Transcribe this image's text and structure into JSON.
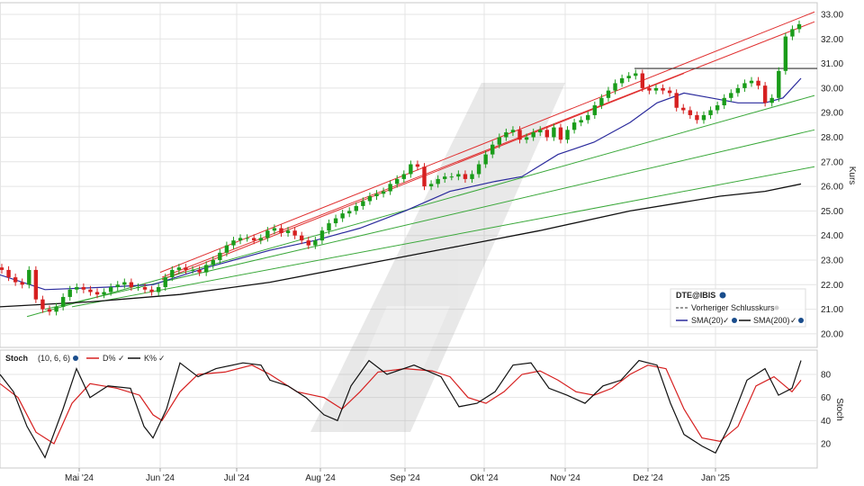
{
  "chart_data": {
    "type": "candlestick",
    "symbol": "DTE@IBIS",
    "x_labels": [
      "Mai '24",
      "Jun '24",
      "Jul '24",
      "Aug '24",
      "Sep '24",
      "Okt '24",
      "Nov '24",
      "Dez '24",
      "Jan '25"
    ],
    "price_panel": {
      "ylabel": "Kurs",
      "ylim": [
        19.6,
        33.3
      ],
      "yticks": [
        "33.00",
        "32.00",
        "31.00",
        "30.00",
        "29.00",
        "28.00",
        "27.00",
        "26.00",
        "25.00",
        "24.00",
        "23.00",
        "22.00",
        "21.00",
        "20.00"
      ],
      "close_series": [
        22.6,
        22.3,
        22.1,
        22.0,
        22.6,
        21.4,
        21.0,
        20.9,
        21.1,
        21.5,
        21.8,
        21.9,
        21.8,
        21.7,
        21.6,
        21.7,
        21.9,
        22.0,
        22.1,
        21.9,
        21.9,
        21.8,
        21.7,
        21.9,
        22.3,
        22.6,
        22.7,
        22.6,
        22.6,
        22.5,
        22.8,
        23.0,
        23.3,
        23.6,
        23.8,
        23.9,
        23.9,
        23.8,
        23.9,
        24.2,
        24.3,
        24.1,
        24.2,
        24.0,
        23.8,
        23.6,
        23.8,
        24.2,
        24.5,
        24.7,
        24.9,
        25.0,
        25.2,
        25.4,
        25.6,
        25.7,
        25.8,
        26.1,
        26.3,
        26.5,
        26.9,
        26.8,
        26.0,
        26.1,
        26.3,
        26.4,
        26.4,
        26.5,
        26.3,
        26.5,
        26.9,
        27.3,
        27.7,
        28.0,
        28.2,
        28.3,
        27.9,
        28.0,
        28.2,
        28.3,
        28.0,
        28.4,
        27.9,
        28.3,
        28.6,
        28.7,
        28.9,
        29.3,
        29.6,
        29.9,
        30.2,
        30.4,
        30.5,
        30.6,
        30.0,
        29.9,
        30.0,
        29.9,
        29.8,
        29.2,
        29.1,
        28.9,
        28.7,
        28.9,
        29.1,
        29.3,
        29.6,
        29.8,
        30.0,
        30.2,
        30.3,
        30.1,
        29.4,
        29.6,
        30.7,
        32.1,
        32.4,
        32.6
      ],
      "close_x_start": 2,
      "close_x_end": 888,
      "sma20": [
        [
          0,
          22.4
        ],
        [
          50,
          21.8
        ],
        [
          120,
          21.9
        ],
        [
          170,
          22.0
        ],
        [
          230,
          22.7
        ],
        [
          300,
          23.4
        ],
        [
          350,
          23.8
        ],
        [
          400,
          24.3
        ],
        [
          450,
          25.0
        ],
        [
          500,
          25.8
        ],
        [
          550,
          26.2
        ],
        [
          580,
          26.4
        ],
        [
          620,
          27.3
        ],
        [
          660,
          27.8
        ],
        [
          700,
          28.6
        ],
        [
          730,
          29.4
        ],
        [
          760,
          29.8
        ],
        [
          790,
          29.6
        ],
        [
          820,
          29.4
        ],
        [
          850,
          29.4
        ],
        [
          870,
          29.6
        ],
        [
          890,
          30.4
        ]
      ],
      "sma200": [
        [
          0,
          21.1
        ],
        [
          100,
          21.3
        ],
        [
          200,
          21.6
        ],
        [
          300,
          22.1
        ],
        [
          400,
          22.8
        ],
        [
          500,
          23.5
        ],
        [
          600,
          24.2
        ],
        [
          700,
          25.0
        ],
        [
          800,
          25.6
        ],
        [
          850,
          25.8
        ],
        [
          890,
          26.1
        ]
      ],
      "red_channel": [
        {
          "from": [
            178,
            22.5
          ],
          "to": [
            905,
            33.1
          ]
        },
        {
          "from": [
            180,
            22.3
          ],
          "to": [
            905,
            32.7
          ]
        },
        {
          "from": [
            180,
            22.2
          ],
          "to": [
            760,
            30.6
          ]
        }
      ],
      "green_lines": [
        {
          "from": [
            30,
            20.7
          ],
          "to": [
            905,
            29.7
          ]
        },
        {
          "from": [
            50,
            21.0
          ],
          "to": [
            905,
            28.3
          ]
        },
        {
          "from": [
            80,
            21.1
          ],
          "to": [
            905,
            26.8
          ]
        }
      ],
      "resistance": {
        "from": [
          705,
          30.8
        ],
        "to": [
          908,
          30.8
        ]
      },
      "legend": {
        "title": "DTE@IBIS",
        "entries": [
          "Vorheriger Schlusskurs",
          "SMA(20)",
          "SMA(200)"
        ]
      }
    },
    "stoch_panel": {
      "label": "Stoch",
      "params": "(10, 6, 6)",
      "ylabel": "Stoch",
      "ylim": [
        5,
        100
      ],
      "yticks": [
        "80",
        "60",
        "40",
        "20"
      ],
      "series": [
        {
          "name": "D%",
          "color": "#d62020",
          "values": [
            [
              0,
              72
            ],
            [
              20,
              60
            ],
            [
              40,
              30
            ],
            [
              60,
              20
            ],
            [
              80,
              55
            ],
            [
              100,
              72
            ],
            [
              130,
              68
            ],
            [
              155,
              62
            ],
            [
              170,
              45
            ],
            [
              180,
              40
            ],
            [
              200,
              65
            ],
            [
              220,
              80
            ],
            [
              250,
              82
            ],
            [
              280,
              88
            ],
            [
              300,
              80
            ],
            [
              330,
              65
            ],
            [
              360,
              60
            ],
            [
              380,
              50
            ],
            [
              400,
              65
            ],
            [
              420,
              82
            ],
            [
              450,
              85
            ],
            [
              480,
              83
            ],
            [
              500,
              78
            ],
            [
              520,
              60
            ],
            [
              540,
              55
            ],
            [
              560,
              65
            ],
            [
              580,
              80
            ],
            [
              600,
              83
            ],
            [
              620,
              75
            ],
            [
              640,
              65
            ],
            [
              660,
              62
            ],
            [
              680,
              68
            ],
            [
              700,
              80
            ],
            [
              720,
              88
            ],
            [
              740,
              85
            ],
            [
              760,
              50
            ],
            [
              780,
              25
            ],
            [
              800,
              22
            ],
            [
              820,
              35
            ],
            [
              840,
              70
            ],
            [
              860,
              78
            ],
            [
              880,
              65
            ],
            [
              890,
              75
            ]
          ]
        },
        {
          "name": "K%",
          "color": "#111111",
          "values": [
            [
              0,
              80
            ],
            [
              15,
              65
            ],
            [
              30,
              35
            ],
            [
              50,
              8
            ],
            [
              70,
              50
            ],
            [
              85,
              85
            ],
            [
              100,
              60
            ],
            [
              120,
              70
            ],
            [
              145,
              68
            ],
            [
              160,
              35
            ],
            [
              170,
              25
            ],
            [
              185,
              50
            ],
            [
              200,
              90
            ],
            [
              220,
              78
            ],
            [
              240,
              85
            ],
            [
              270,
              90
            ],
            [
              290,
              88
            ],
            [
              300,
              75
            ],
            [
              320,
              70
            ],
            [
              340,
              60
            ],
            [
              360,
              45
            ],
            [
              375,
              40
            ],
            [
              390,
              70
            ],
            [
              410,
              92
            ],
            [
              430,
              80
            ],
            [
              460,
              88
            ],
            [
              490,
              78
            ],
            [
              510,
              52
            ],
            [
              530,
              55
            ],
            [
              550,
              65
            ],
            [
              570,
              88
            ],
            [
              590,
              90
            ],
            [
              610,
              68
            ],
            [
              630,
              62
            ],
            [
              650,
              55
            ],
            [
              670,
              70
            ],
            [
              690,
              75
            ],
            [
              710,
              92
            ],
            [
              730,
              88
            ],
            [
              745,
              55
            ],
            [
              760,
              28
            ],
            [
              780,
              18
            ],
            [
              795,
              12
            ],
            [
              810,
              35
            ],
            [
              830,
              75
            ],
            [
              850,
              85
            ],
            [
              865,
              62
            ],
            [
              880,
              68
            ],
            [
              890,
              92
            ]
          ]
        }
      ]
    }
  }
}
